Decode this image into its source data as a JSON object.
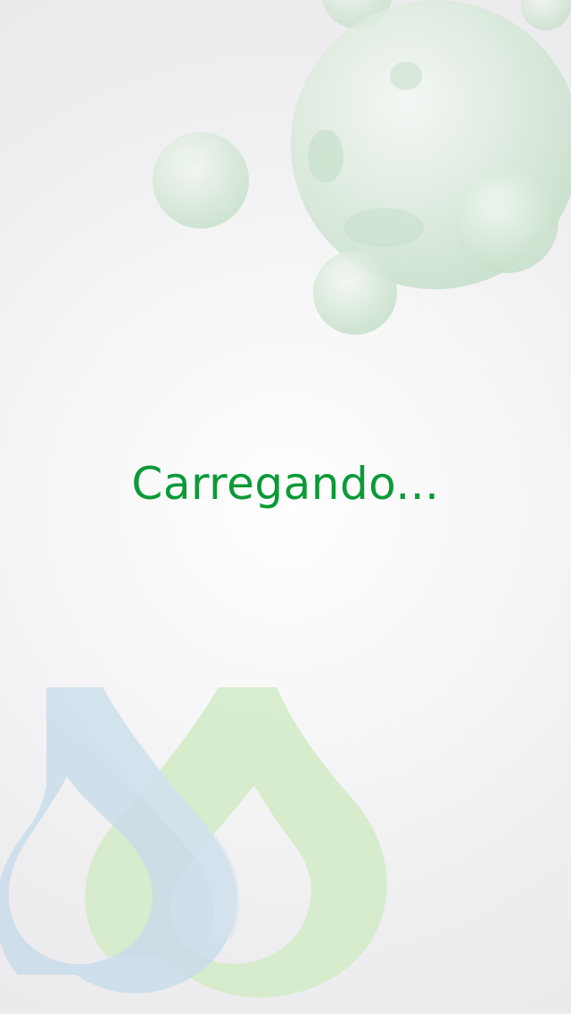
{
  "loading": {
    "text": "Carregando..."
  },
  "colors": {
    "accent": "#0b9a37",
    "bubble": "#cfe6d3",
    "drop_blue": "#c9dcea",
    "drop_green": "#d3ebc8",
    "background": "#f0eff1"
  },
  "icons": {
    "bubbles": "decorative-bubbles-icon",
    "logo": "water-drops-logo-icon"
  }
}
